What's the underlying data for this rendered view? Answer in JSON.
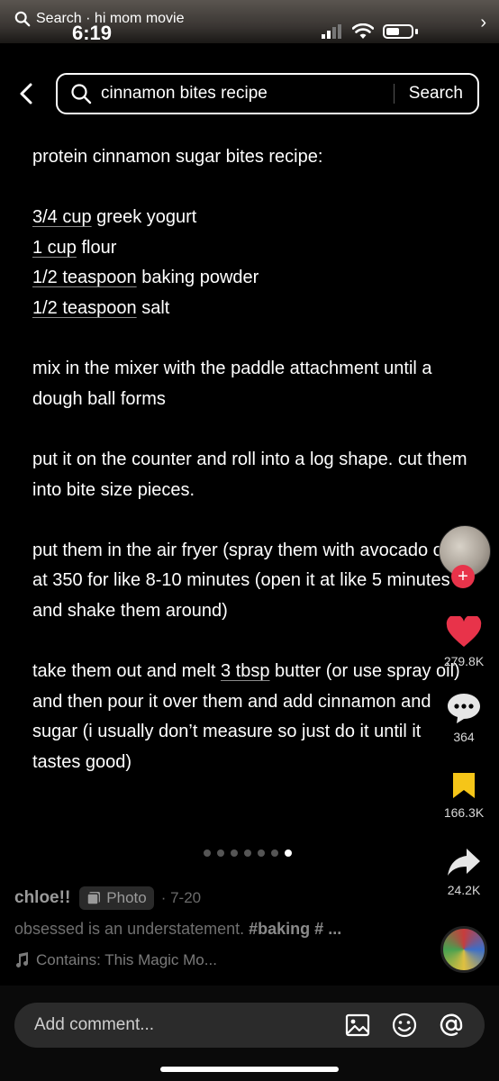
{
  "status_bar": {
    "back_app": "Search · hi mom movie",
    "time": "6:19"
  },
  "search": {
    "query": "cinnamon bites recipe",
    "button_label": "Search"
  },
  "recipe": {
    "title": "protein cinnamon sugar bites recipe:",
    "ingredients": [
      {
        "amount": "3/4 cup",
        "item": " greek yogurt"
      },
      {
        "amount": "1 cup",
        "item": " flour"
      },
      {
        "amount": "1/2 teaspoon",
        "item": " baking powder"
      },
      {
        "amount": "1/2 teaspoon",
        "item": " salt"
      }
    ],
    "step1": "mix in the mixer with the paddle attachment until a dough ball forms",
    "step2": "put it on the counter and roll into a log shape. cut them into bite size pieces.",
    "step3": "put them in the air fryer (spray them with avocado oil) at 350 for like 8-10 minutes (open it at like 5 minutes and shake them around)",
    "step4_pre": "take them out and melt ",
    "step4_link": "3 tbsp",
    "step4_post": " butter (or use spray oil) and then pour it over them and add cinnamon and sugar (i usually don’t measure so just do it until it tastes good)"
  },
  "rail": {
    "likes": "279.8K",
    "comments": "364",
    "saves": "166.3K",
    "shares": "24.2K",
    "plus": "+"
  },
  "pager": {
    "total": 7,
    "active": 7
  },
  "post": {
    "author": "chloe!!",
    "badge": "Photo",
    "date": "· 7-20",
    "caption_text": "obsessed is an understatement. ",
    "caption_tag": "#baking # ...",
    "music": "Contains: This Magic Mo..."
  },
  "comment": {
    "placeholder": "Add comment..."
  },
  "colors": {
    "like": "#e8334a",
    "save": "#f5c518"
  }
}
